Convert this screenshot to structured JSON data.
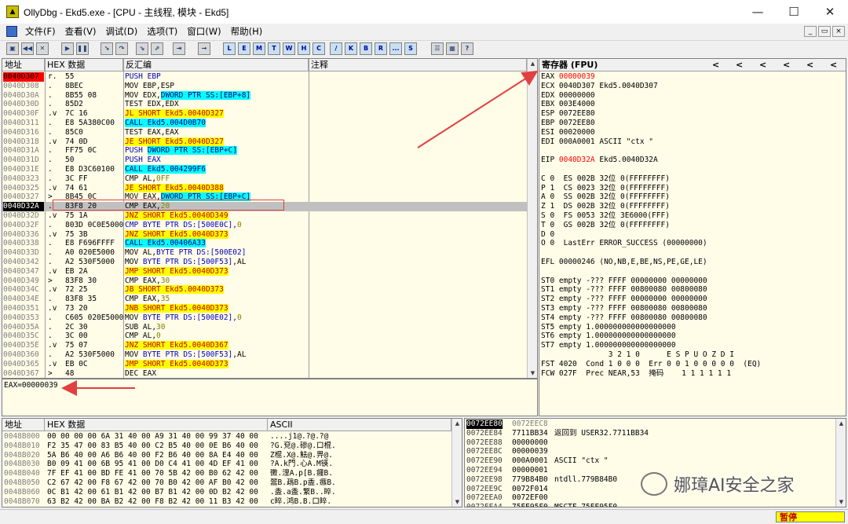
{
  "window": {
    "title": "OllyDbg - Ekd5.exe - [CPU - 主线程, 模块 - Ekd5]",
    "minimize": "—",
    "maximize": "☐",
    "close": "✕"
  },
  "menu": [
    "文件(F)",
    "查看(V)",
    "调试(D)",
    "选项(T)",
    "窗口(W)",
    "帮助(H)"
  ],
  "mdi_controls": [
    "_",
    "▭",
    "×"
  ],
  "toolbar": {
    "letters": [
      "L",
      "E",
      "M",
      "T",
      "W",
      "H",
      "C",
      "/",
      "K",
      "B",
      "R",
      "...",
      "S"
    ]
  },
  "disasm": {
    "headers": {
      "addr": "地址",
      "hex": "HEX 数据",
      "asm": "反汇编",
      "comment": "注释"
    },
    "rows": [
      {
        "addr": "0040D307",
        "mark": "r.",
        "hex": "55",
        "asm": [
          {
            "t": "PUSH EBP",
            "c": "b"
          }
        ]
      },
      {
        "addr": "0040D308",
        "mark": ".",
        "hex": "8BEC",
        "asm": [
          {
            "t": "MOV EBP,ESP",
            "c": ""
          }
        ]
      },
      {
        "addr": "0040D30A",
        "mark": ".",
        "hex": "8B55 08",
        "asm": [
          {
            "t": "MOV EDX,",
            "c": ""
          },
          {
            "t": "DWORD PTR SS:[EBP+8]",
            "c": "c"
          }
        ]
      },
      {
        "addr": "0040D30D",
        "mark": ".",
        "hex": "85D2",
        "asm": [
          {
            "t": "TEST EDX,EDX",
            "c": ""
          }
        ]
      },
      {
        "addr": "0040D30F",
        "mark": ".v",
        "hex": "7C 16",
        "asm": [
          {
            "t": "JL SHORT Ekd5.0040D327",
            "c": "y"
          }
        ]
      },
      {
        "addr": "0040D311",
        "mark": ".",
        "hex": "E8 5A380C00",
        "asm": [
          {
            "t": "CALL Ekd5.004D0B70",
            "c": "c"
          }
        ]
      },
      {
        "addr": "0040D316",
        "mark": ".",
        "hex": "85C0",
        "asm": [
          {
            "t": "TEST EAX,EAX",
            "c": ""
          }
        ]
      },
      {
        "addr": "0040D318",
        "mark": ".v",
        "hex": "74 0D",
        "asm": [
          {
            "t": "JE SHORT Ekd5.0040D327",
            "c": "y"
          }
        ]
      },
      {
        "addr": "0040D31A",
        "mark": ".",
        "hex": "FF75 0C",
        "asm": [
          {
            "t": "PUSH ",
            "c": "b"
          },
          {
            "t": "DWORD PTR SS:[EBP+C]",
            "c": "c"
          }
        ]
      },
      {
        "addr": "0040D31D",
        "mark": ".",
        "hex": "50",
        "asm": [
          {
            "t": "PUSH EAX",
            "c": "b"
          }
        ]
      },
      {
        "addr": "0040D31E",
        "mark": ".",
        "hex": "E8 D3C60100",
        "asm": [
          {
            "t": "CALL Ekd5.004299F6",
            "c": "c"
          }
        ]
      },
      {
        "addr": "0040D323",
        "mark": ".",
        "hex": "3C FF",
        "asm": [
          {
            "t": "CMP AL,",
            "c": ""
          },
          {
            "t": "0FF",
            "c": "n"
          }
        ]
      },
      {
        "addr": "0040D325",
        "mark": ".v",
        "hex": "74 61",
        "asm": [
          {
            "t": "JE SHORT Ekd5.0040D388",
            "c": "y"
          }
        ]
      },
      {
        "addr": "0040D327",
        "mark": ">",
        "hex": "8B45 0C",
        "asm": [
          {
            "t": "MOV EAX,",
            "c": ""
          },
          {
            "t": "DWORD PTR SS:[EBP+C]",
            "c": "c"
          }
        ]
      },
      {
        "addr": "0040D32A",
        "mark": ".",
        "hex": "83F8 20",
        "asm": [
          {
            "t": "CMP EAX,",
            "c": ""
          },
          {
            "t": "20",
            "c": "n"
          }
        ]
      },
      {
        "addr": "0040D32D",
        "mark": ".v",
        "hex": "75 1A",
        "asm": [
          {
            "t": "JNZ SHORT Ekd5.0040D349",
            "c": "y"
          }
        ]
      },
      {
        "addr": "0040D32F",
        "mark": ".",
        "hex": "803D 0C0E5000",
        "asm": [
          {
            "t": "CMP BYTE PTR DS:[500E0C],",
            "c": "b"
          },
          {
            "t": "0",
            "c": "n"
          }
        ]
      },
      {
        "addr": "0040D336",
        "mark": ".v",
        "hex": "75 3B",
        "asm": [
          {
            "t": "JNZ SHORT Ekd5.0040D373",
            "c": "y"
          }
        ]
      },
      {
        "addr": "0040D338",
        "mark": ".",
        "hex": "E8 F696FFFF",
        "asm": [
          {
            "t": "CALL Ekd5.00406A33",
            "c": "c"
          }
        ]
      },
      {
        "addr": "0040D33D",
        "mark": ".",
        "hex": "A0 020E5000",
        "asm": [
          {
            "t": "MOV AL,",
            "c": ""
          },
          {
            "t": "BYTE PTR DS:[500E02]",
            "c": "b"
          }
        ]
      },
      {
        "addr": "0040D342",
        "mark": ".",
        "hex": "A2 530F5000",
        "asm": [
          {
            "t": "MOV ",
            "c": ""
          },
          {
            "t": "BYTE PTR DS:[500F53]",
            "c": "b"
          },
          {
            "t": ",AL",
            "c": ""
          }
        ]
      },
      {
        "addr": "0040D347",
        "mark": ".v",
        "hex": "EB 2A",
        "asm": [
          {
            "t": "JMP SHORT Ekd5.0040D373",
            "c": "y"
          }
        ]
      },
      {
        "addr": "0040D349",
        "mark": ">",
        "hex": "83F8 30",
        "asm": [
          {
            "t": "CMP EAX,",
            "c": ""
          },
          {
            "t": "30",
            "c": "n"
          }
        ]
      },
      {
        "addr": "0040D34C",
        "mark": ".v",
        "hex": "72 25",
        "asm": [
          {
            "t": "JB SHORT Ekd5.0040D373",
            "c": "y"
          }
        ]
      },
      {
        "addr": "0040D34E",
        "mark": ".",
        "hex": "83F8 35",
        "asm": [
          {
            "t": "CMP EAX,",
            "c": ""
          },
          {
            "t": "35",
            "c": "n"
          }
        ]
      },
      {
        "addr": "0040D351",
        "mark": ".v",
        "hex": "73 20",
        "asm": [
          {
            "t": "JNB SHORT Ekd5.0040D373",
            "c": "y"
          }
        ]
      },
      {
        "addr": "0040D353",
        "mark": ".",
        "hex": "C605 020E5000",
        "asm": [
          {
            "t": "MOV ",
            "c": ""
          },
          {
            "t": "BYTE PTR DS:[500E02],",
            "c": "b"
          },
          {
            "t": "0",
            "c": "n"
          }
        ]
      },
      {
        "addr": "0040D35A",
        "mark": ".",
        "hex": "2C 30",
        "asm": [
          {
            "t": "SUB AL,",
            "c": ""
          },
          {
            "t": "30",
            "c": "n"
          }
        ]
      },
      {
        "addr": "0040D35C",
        "mark": ".",
        "hex": "3C 00",
        "asm": [
          {
            "t": "CMP AL,",
            "c": ""
          },
          {
            "t": "0",
            "c": "n"
          }
        ]
      },
      {
        "addr": "0040D35E",
        "mark": ".v",
        "hex": "75 07",
        "asm": [
          {
            "t": "JNZ SHORT Ekd5.0040D367",
            "c": "y"
          }
        ]
      },
      {
        "addr": "0040D360",
        "mark": ".",
        "hex": "A2 530F5000",
        "asm": [
          {
            "t": "MOV ",
            "c": ""
          },
          {
            "t": "BYTE PTR DS:[500F53]",
            "c": "b"
          },
          {
            "t": ",AL",
            "c": ""
          }
        ]
      },
      {
        "addr": "0040D365",
        "mark": ".v",
        "hex": "EB 0C",
        "asm": [
          {
            "t": "JMP SHORT Ekd5.0040D373",
            "c": "y"
          }
        ]
      },
      {
        "addr": "0040D367",
        "mark": ">",
        "hex": "48",
        "asm": [
          {
            "t": "DEC EAX",
            "c": ""
          }
        ]
      }
    ]
  },
  "info_line": "EAX=00000039",
  "registers": {
    "header": "寄存器 (FPU)",
    "nav": [
      "<",
      "<",
      "<",
      "<",
      "<",
      "<"
    ],
    "lines": [
      {
        "t": "EAX ",
        "v": "00000039",
        "red": true
      },
      {
        "t": "ECX 0040D307 Ekd5.0040D307"
      },
      {
        "t": "EDX 00000000"
      },
      {
        "t": "EBX 003E4000"
      },
      {
        "t": "ESP 0072EE80"
      },
      {
        "t": "EBP 0072EE80"
      },
      {
        "t": "ESI 00020000"
      },
      {
        "t": "EDI 000A0001 ASCII \"ctx \""
      },
      {
        "t": ""
      },
      {
        "t": "EIP ",
        "v": "0040D32A",
        "red": true,
        "rest": " Ekd5.0040D32A"
      },
      {
        "t": ""
      },
      {
        "t": "C 0  ES 002B 32位 0(FFFFFFFF)"
      },
      {
        "t": "P 1  CS 0023 32位 0(FFFFFFFF)"
      },
      {
        "t": "A 0  SS 002B 32位 0(FFFFFFFF)"
      },
      {
        "t": "Z 1  DS 002B 32位 0(FFFFFFFF)"
      },
      {
        "t": "S 0  FS 0053 32位 3E6000(FFF)"
      },
      {
        "t": "T 0  GS 002B 32位 0(FFFFFFFF)"
      },
      {
        "t": "D 0"
      },
      {
        "t": "O 0  LastErr ERROR_SUCCESS (00000000)"
      },
      {
        "t": ""
      },
      {
        "t": "EFL 00000246 (NO,NB,E,BE,NS,PE,GE,LE)"
      },
      {
        "t": ""
      },
      {
        "t": "ST0 empty -??? FFFF 00000000 00000000"
      },
      {
        "t": "ST1 empty -??? FFFF 00800080 00800080"
      },
      {
        "t": "ST2 empty -??? FFFF 00000000 00000000"
      },
      {
        "t": "ST3 empty -??? FFFF 00800080 00800080"
      },
      {
        "t": "ST4 empty -??? FFFF 00800080 00800080"
      },
      {
        "t": "ST5 empty 1.000000000000000000"
      },
      {
        "t": "ST6 empty 1.000000000000000000"
      },
      {
        "t": "ST7 empty 1.000000000000000000"
      },
      {
        "t": "               3 2 1 0      E S P U O Z D I"
      },
      {
        "t": "FST 4020  Cond 1 0 0 0  Err 0 0 1 0 0 0 0 0  (EQ)"
      },
      {
        "t": "FCW 027F  Prec NEAR,53  掩码    1 1 1 1 1 1"
      }
    ]
  },
  "dump": {
    "headers": {
      "addr": "地址",
      "hex": "HEX 数据",
      "ascii": "ASCII"
    },
    "rows": [
      {
        "addr": "0048B000",
        "hex": "00 00 00 00 6A 31 40 00 A9 31 40 00 99 37 40 00",
        "ascii": "....j1@.?@.?@"
      },
      {
        "addr": "0048B010",
        "hex": "F2 35 47 00 83 B5 40 00 C2 B5 40 00 0E B6 40 00",
        "ascii": "?G.兗@.磣@.口棍."
      },
      {
        "addr": "0048B020",
        "hex": "5A B6 40 00 A6 B6 40 00 F2 B6 40 00 8A E4 40 00",
        "ascii": "Z棍.X@.魼@.畀@."
      },
      {
        "addr": "0048B030",
        "hex": "B0 09 41 00 6B 95 41 00 D0 C4 41 00 4D EF 41 00",
        "ascii": "?A.k門.心A.M锳."
      },
      {
        "addr": "0048B040",
        "hex": "7F EF 41 00 BD FE 41 00 70 5B 42 00 B0 62 42 00",
        "ascii": "黴.浬A.p[B.癰B."
      },
      {
        "addr": "0048B050",
        "hex": "C2 67 42 00 F8 67 42 00 70 B0 42 00 AF B0 42 00",
        "ascii": "翯B.鴊B.p盉.瘯B."
      },
      {
        "addr": "0048B060",
        "hex": "0C B1 42 00 61 B1 42 00 B7 B1 42 00 0D B2 42 00",
        "ascii": ".盉.a盉.繁B..睟."
      },
      {
        "addr": "0048B070",
        "hex": "63 B2 42 00 BA B2 42 00 F8 B2 42 00 11 B3 42 00",
        "ascii": "c睟.鸿B.B.口睟."
      }
    ]
  },
  "stack": {
    "rows": [
      {
        "addr": "0072EE80",
        "val": "0072EEC8",
        "comment": ""
      },
      {
        "addr": "0072EE84",
        "val": "7711BB34",
        "comment": "返回到 USER32.7711BB34"
      },
      {
        "addr": "0072EE88",
        "val": "00000000",
        "comment": ""
      },
      {
        "addr": "0072EE8C",
        "val": "00000039",
        "comment": ""
      },
      {
        "addr": "0072EE90",
        "val": "000A0001",
        "comment": "ASCII \"ctx \""
      },
      {
        "addr": "0072EE94",
        "val": "00000001",
        "comment": ""
      },
      {
        "addr": "0072EE98",
        "val": "779B84B0",
        "comment": "ntdll.779B84B0"
      },
      {
        "addr": "0072EE9C",
        "val": "0072F014",
        "comment": ""
      },
      {
        "addr": "0072EEA0",
        "val": "0072EF00",
        "comment": ""
      },
      {
        "addr": "0072EEA4",
        "val": "75EE95F0",
        "comment": "MSCTF.75EE95F0"
      }
    ]
  },
  "status": {
    "state": "暂停"
  },
  "watermark": {
    "text": "娜璋AI安全之家"
  },
  "colors": {
    "highlight_yellow": "#ffff00",
    "highlight_cyan": "#00ffff",
    "current_addr_red": "#ff0000",
    "annotation_red": "#e04040",
    "pane_bg": "#fffce8"
  }
}
